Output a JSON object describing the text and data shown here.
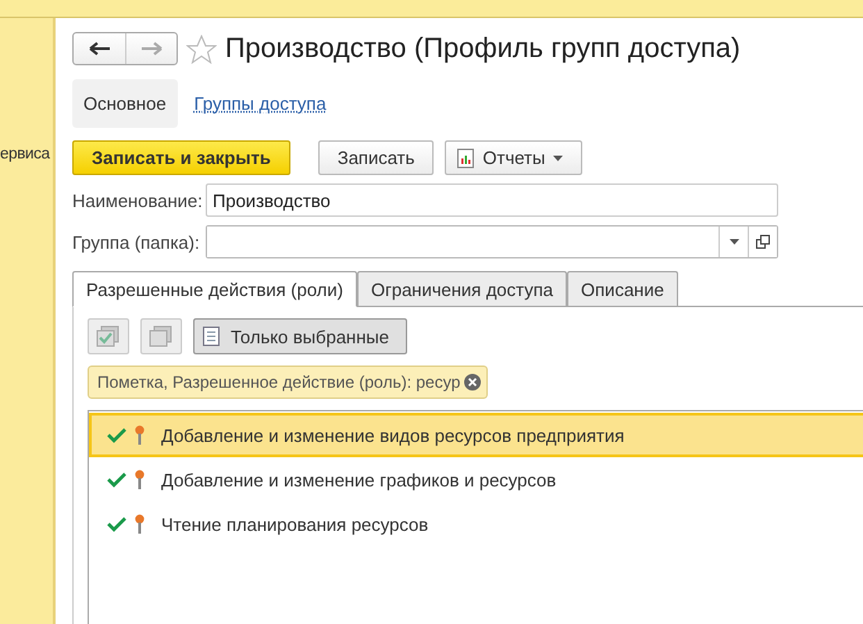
{
  "sidebar": {
    "label": "ервиса"
  },
  "title": "Производство (Профиль групп доступа)",
  "favorite": false,
  "nav_tabs": [
    {
      "label": "Основное",
      "selected": true
    },
    {
      "label": "Группы доступа",
      "selected": false
    }
  ],
  "toolbar": {
    "primary": "Записать и закрыть",
    "save": "Записать",
    "reports": "Отчеты"
  },
  "fields": [
    {
      "label": "Наименование:",
      "value": "Производство",
      "kind": "text"
    },
    {
      "label": "Группа (папка):",
      "kind": "choice"
    }
  ],
  "tabs": [
    {
      "label": "Разрешенные действия (роли)",
      "selected": true
    },
    {
      "label": "Ограничения доступа",
      "selected": false
    },
    {
      "label": "Описание",
      "selected": false
    }
  ],
  "filter_toggle": {
    "label": "Только выбранные",
    "on": true
  },
  "filter_tag": "Пометка, Разрешенное действие (роль): ресур",
  "rows": [
    {
      "label": "Добавление и изменение видов ресурсов предприятия",
      "checked": true,
      "selected": true
    },
    {
      "label": "Добавление и изменение графиков и ресурсов",
      "checked": true,
      "selected": false
    },
    {
      "label": "Чтение планирования ресурсов",
      "checked": true,
      "selected": false
    }
  ]
}
